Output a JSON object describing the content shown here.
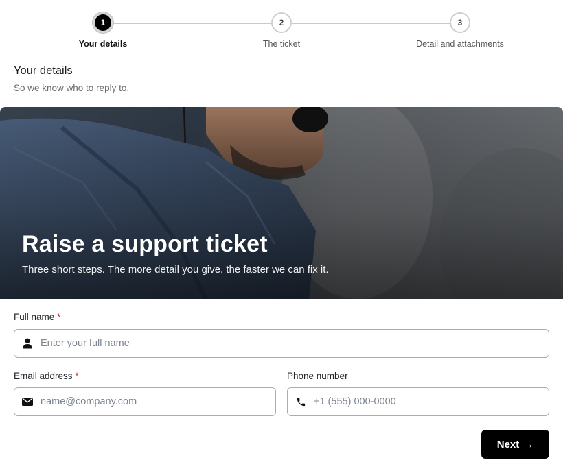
{
  "stepper": {
    "steps": [
      {
        "number": "1",
        "label": "Your details",
        "active": true
      },
      {
        "number": "2",
        "label": "The ticket",
        "active": false
      },
      {
        "number": "3",
        "label": "Detail and attachments",
        "active": false
      }
    ]
  },
  "section": {
    "title": "Your details",
    "subtitle": "So we know who to reply to."
  },
  "hero": {
    "title": "Raise a support ticket",
    "subtitle": "Three short steps. The more detail you give, the faster we can fix it."
  },
  "form": {
    "full_name": {
      "label": "Full name",
      "required_mark": "*",
      "placeholder": "Enter your full name",
      "value": "",
      "icon": "user-icon"
    },
    "email": {
      "label": "Email address",
      "required_mark": "*",
      "placeholder": "name@company.com",
      "value": "",
      "icon": "envelope-icon"
    },
    "phone": {
      "label": "Phone number",
      "placeholder": "+1 (555) 000-0000",
      "value": "",
      "icon": "phone-icon"
    }
  },
  "actions": {
    "next_label": "Next",
    "next_arrow": "→"
  },
  "colors": {
    "primary": "#000000",
    "required": "#d11a2a",
    "input_border": "#a8adb3",
    "placeholder": "#7d8590"
  }
}
